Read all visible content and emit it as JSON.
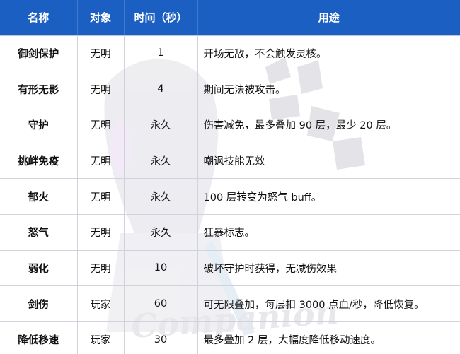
{
  "table": {
    "headers": [
      "名称",
      "对象",
      "时间（秒）",
      "用途"
    ],
    "rows": [
      {
        "name": "御剑保护",
        "target": "无明",
        "time": "1",
        "use": "开场无敌，不会触发灵核。"
      },
      {
        "name": "有形无影",
        "target": "无明",
        "time": "4",
        "use": "期间无法被攻击。"
      },
      {
        "name": "守护",
        "target": "无明",
        "time": "永久",
        "use": "伤害减免，最多叠加 90 层，最少 20 层。"
      },
      {
        "name": "挑衅免疫",
        "target": "无明",
        "time": "永久",
        "use": "嘲讽技能无效"
      },
      {
        "name": "郁火",
        "target": "无明",
        "time": "永久",
        "use": "100 层转变为怒气 buff。"
      },
      {
        "name": "怒气",
        "target": "无明",
        "time": "永久",
        "use": "狂暴标志。"
      },
      {
        "name": "弱化",
        "target": "无明",
        "time": "10",
        "use": "破坏守护时获得，无减伤效果"
      },
      {
        "name": "剑伤",
        "target": "玩家",
        "time": "60",
        "use": "可无限叠加，每层扣 3000 点血/秒，降低恢复。"
      },
      {
        "name": "降低移速",
        "target": "玩家",
        "time": "30",
        "use": "最多叠加 2 层，大幅度降低移动速度。"
      }
    ]
  },
  "colors": {
    "header_bg": "#1c5fc2",
    "header_text": "#ffffff",
    "grid": "#cfd4dc"
  },
  "watermark": {
    "text": "Companion"
  }
}
